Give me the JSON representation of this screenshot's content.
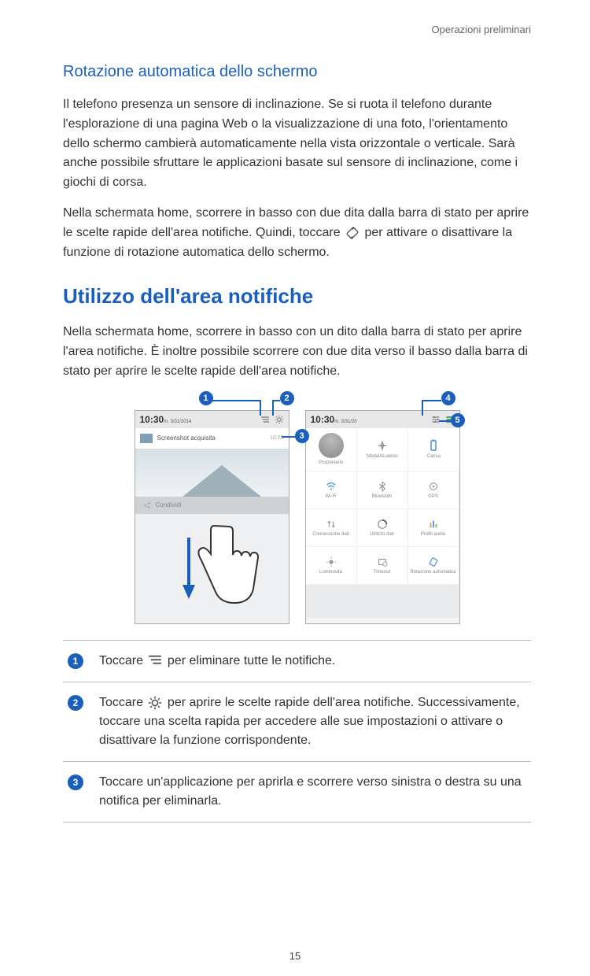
{
  "header": "Operazioni preliminari",
  "page_number": "15",
  "section1": {
    "heading": "Rotazione automatica dello schermo",
    "para1": "Il telefono presenza un sensore di inclinazione. Se si ruota il telefono durante l'esplorazione di una pagina Web o la visualizzazione di una foto, l'orientamento dello schermo cambierà automaticamente nella vista orizzontale o verticale. Sarà anche possibile sfruttare le applicazioni basate sul sensore di inclinazione, come i giochi di corsa.",
    "para2_part1": "Nella schermata home, scorrere in basso con due dita dalla barra di stato per aprire le scelte rapide dell'area notifiche. Quindi, toccare ",
    "para2_part2": " per attivare o disattivare la funzione di rotazione automatica dello schermo."
  },
  "section2": {
    "heading": "Utilizzo dell'area notifiche",
    "para1": "Nella schermata home, scorrere in basso con un dito dalla barra di stato per aprire l'area notifiche. È inoltre possibile scorrere con due dita verso il basso dalla barra di stato per aprire le scelte rapide dell'area notifiche."
  },
  "callouts": [
    "1",
    "2",
    "3",
    "4",
    "5"
  ],
  "phone_left": {
    "time": "10:30",
    "time_suffix": "m. 3/31/2014",
    "notification_title": "Screenshot acquisita",
    "notification_time": "10:29",
    "share_label": "Condividi"
  },
  "phone_right": {
    "time": "10:30",
    "time_suffix": "m. 3/31/20",
    "owner_label": "Proprietario",
    "tiles": [
      {
        "label": "Modalità aereo"
      },
      {
        "label": "Carica"
      },
      {
        "label": "Wi-Fi"
      },
      {
        "label": "Bluetooth"
      },
      {
        "label": "GPS"
      },
      {
        "label": "Connessione dati"
      },
      {
        "label": "Utilizzo dati"
      },
      {
        "label": "Profili audio"
      },
      {
        "label": "Luminosità"
      },
      {
        "label": "Timeout"
      },
      {
        "label": "Rotazione automatica"
      }
    ]
  },
  "legend": {
    "1": {
      "pre": "Toccare ",
      "post": " per eliminare tutte le notifiche."
    },
    "2": {
      "pre": "Toccare ",
      "mid": " per aprire le scelte rapide dell'area notifiche. Successivamente, toccare una scelta rapida per accedere alle sue impostazioni o attivare o disattivare la funzione corrispondente."
    },
    "3": "Toccare un'applicazione per aprirla e scorrere verso sinistra o destra su una notifica per eliminarla."
  }
}
